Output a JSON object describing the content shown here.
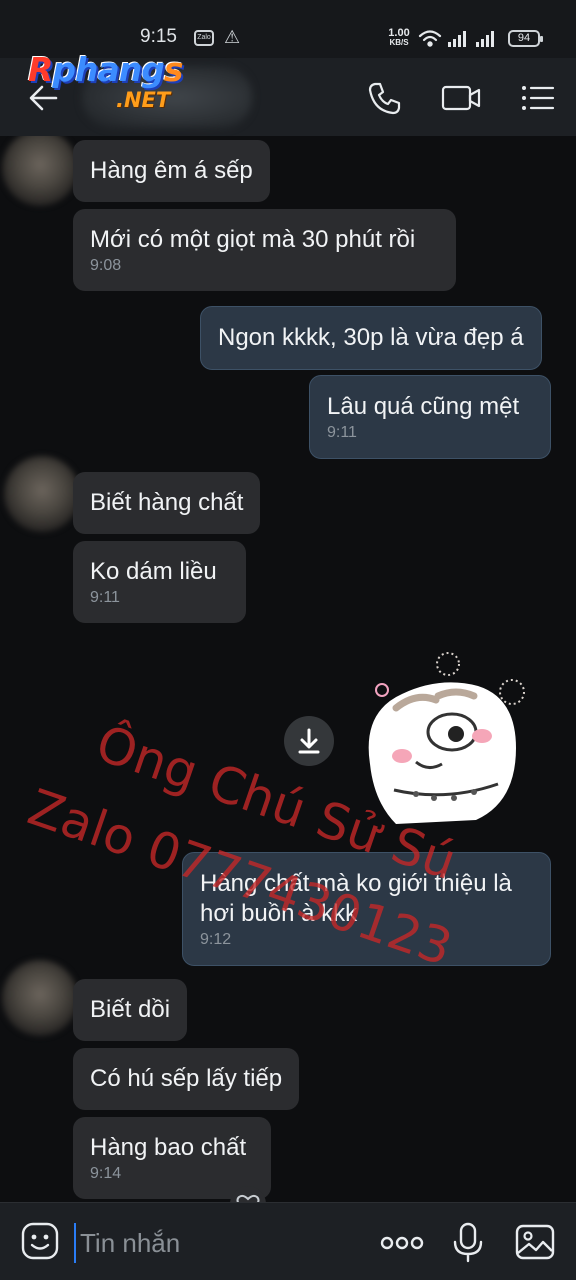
{
  "status_bar": {
    "time": "9:15",
    "zalo_badge": "Zalo",
    "net_speed_value": "1.00",
    "net_speed_unit": "KB/S",
    "battery": "94",
    "icons": [
      "zalo-notification-icon",
      "warning-icon",
      "wifi-icon",
      "signal-icon",
      "signal-icon",
      "battery-icon"
    ]
  },
  "header": {
    "icons": [
      "back-arrow-icon",
      "phone-icon",
      "video-call-icon",
      "menu-list-icon"
    ],
    "logo_text_a": "R",
    "logo_text_b": "phang",
    "logo_text_c": "s",
    "logo_sub": ".NET"
  },
  "messages": [
    {
      "side": "in",
      "text": "Hàng êm á sếp",
      "time": ""
    },
    {
      "side": "in",
      "text": "Mới có một giọt mà 30 phút rồi",
      "time": "9:08"
    },
    {
      "side": "out",
      "text": "Ngon kkkk, 30p là vừa đẹp á",
      "time": ""
    },
    {
      "side": "out",
      "text": "Lâu quá  cũng mệt",
      "time": "9:11"
    },
    {
      "side": "in",
      "text": "Biết hàng chất",
      "time": ""
    },
    {
      "side": "in",
      "text": "Ko dám liều",
      "time": "9:11"
    },
    {
      "side": "out",
      "text": "Hàng chất mà ko giới thiệu là hơi buồn à kkk",
      "time": "9:12"
    },
    {
      "side": "in",
      "text": "Biết dồi",
      "time": ""
    },
    {
      "side": "in",
      "text": "Có hú sếp lấy tiếp",
      "time": ""
    },
    {
      "side": "in",
      "text": "Hàng bao chất",
      "time": "9:14"
    }
  ],
  "sticker": {
    "icon": "cat-sticker-icon"
  },
  "watermark": {
    "line1": "Ông Chú Sử Sú",
    "line2": "Zalo 0777430123"
  },
  "input_bar": {
    "placeholder": "Tin nhắn",
    "icons": [
      "emoji-icon",
      "more-icon",
      "microphone-icon",
      "image-icon"
    ]
  },
  "colors": {
    "background": "#0d0e10",
    "incoming_bubble": "#2b2c2f",
    "outgoing_bubble": "#2c3846",
    "accent": "#2a7df6",
    "watermark": "#c82828"
  }
}
